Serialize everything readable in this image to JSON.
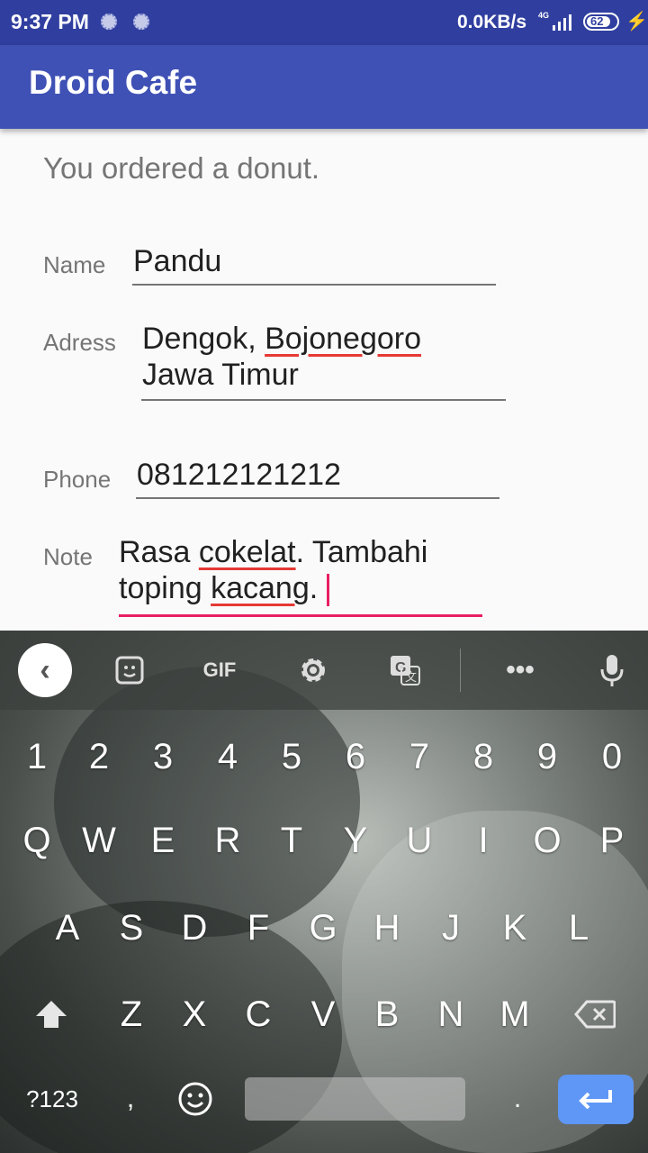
{
  "status_bar": {
    "time": "9:37 PM",
    "net_speed": "0.0KB/s",
    "network": "4G",
    "battery": "62"
  },
  "app_bar": {
    "title": "Droid Cafe"
  },
  "order": {
    "message": "You ordered a donut."
  },
  "form": {
    "name_label": "Name",
    "name_value": "Pandu",
    "address_label": "Adress",
    "address_line1_a": "Dengok, ",
    "address_line1_b": "Bojonegoro",
    "address_line2": "Jawa Timur",
    "phone_label": "Phone",
    "phone_value": "081212121212",
    "note_label": "Note",
    "note_l1_a": "Rasa ",
    "note_l1_b": "cokelat",
    "note_l1_c": ". Tambahi",
    "note_l2_a": "toping ",
    "note_l2_b": "kacang",
    "note_l2_c": "."
  },
  "keyboard": {
    "toolbar": {
      "gif": "GIF"
    },
    "row_numbers": [
      "1",
      "2",
      "3",
      "4",
      "5",
      "6",
      "7",
      "8",
      "9",
      "0"
    ],
    "row_1": [
      "Q",
      "W",
      "E",
      "R",
      "T",
      "Y",
      "U",
      "I",
      "O",
      "P"
    ],
    "row_2": [
      "A",
      "S",
      "D",
      "F",
      "G",
      "H",
      "J",
      "K",
      "L"
    ],
    "row_3": [
      "Z",
      "X",
      "C",
      "V",
      "B",
      "N",
      "M"
    ],
    "symbols": "?123",
    "comma": ",",
    "period": "."
  }
}
